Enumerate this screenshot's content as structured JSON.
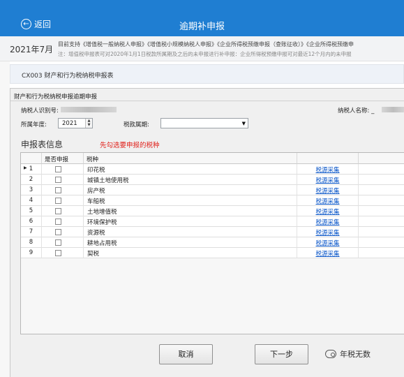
{
  "header": {
    "back_label": "返回",
    "title": "逾期补申报"
  },
  "notice": {
    "month": "2021年7月",
    "line1": "目前支持《增值税一般纳税人申报》《增值税小规模纳税人申报》《企业所得税预缴申报（查账征收）》《企业所得税预缴申",
    "line2": "注：增值税申报表可对2020年1月1日税款所属期及之后的未申报进行补申报：企业所得税预缴申报可对最近12个月内的未申报"
  },
  "form_code": "CX003  财产和行为税纳税申报表",
  "window": {
    "title": "财产和行为税纳税申报逾期申报",
    "taxpayer_id_label": "纳税人识别号:",
    "taxpayer_name_label": "纳税人名称: _",
    "year_label": "所属年度:",
    "year_value": "2021",
    "period_label": "税款属期:",
    "period_value": ""
  },
  "section": {
    "title": "申报表信息",
    "hint": "先勾选要申报的税种"
  },
  "table": {
    "columns": [
      "是否申报",
      "税种",
      "",
      ""
    ],
    "rows": [
      {
        "num": "1",
        "tax": "印花税",
        "link": "税源采集"
      },
      {
        "num": "2",
        "tax": "城镇土地使用税",
        "link": "税源采集"
      },
      {
        "num": "3",
        "tax": "房产税",
        "link": "税源采集"
      },
      {
        "num": "4",
        "tax": "车船税",
        "link": "税源采集"
      },
      {
        "num": "5",
        "tax": "土地增值税",
        "link": "税源采集"
      },
      {
        "num": "6",
        "tax": "环境保护税",
        "link": "税源采集"
      },
      {
        "num": "7",
        "tax": "资源税",
        "link": "税源采集"
      },
      {
        "num": "8",
        "tax": "耕地占用税",
        "link": "税源采集"
      },
      {
        "num": "9",
        "tax": "契税",
        "link": "税源采集"
      }
    ]
  },
  "buttons": {
    "cancel": "取消",
    "next": "下一步"
  },
  "watermark": "年税无数"
}
